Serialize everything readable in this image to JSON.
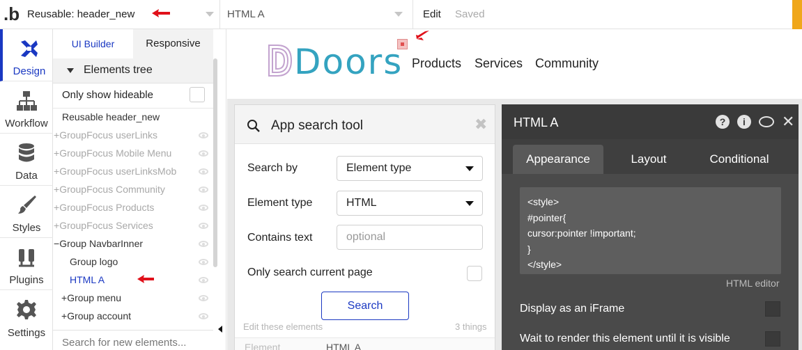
{
  "topbar": {
    "logo": "b",
    "page": "Reusable: header_new",
    "element": "HTML A",
    "edit_label": "Edit",
    "status": "Saved"
  },
  "leftnav": [
    {
      "label": "Design",
      "icon": "design-icon"
    },
    {
      "label": "Workflow",
      "icon": "workflow-icon"
    },
    {
      "label": "Data",
      "icon": "database-icon"
    },
    {
      "label": "Styles",
      "icon": "brush-icon"
    },
    {
      "label": "Plugins",
      "icon": "plug-icon"
    },
    {
      "label": "Settings",
      "icon": "gear-icon"
    }
  ],
  "panel": {
    "tabs": [
      "UI Builder",
      "Responsive"
    ],
    "tree_title": "Elements tree",
    "hideable_label": "Only show hideable",
    "items": [
      {
        "prefix": "",
        "label": "Reusable header_new"
      },
      {
        "prefix": "+",
        "label": "GroupFocus userLinks"
      },
      {
        "prefix": "+",
        "label": "GroupFocus Mobile Menu"
      },
      {
        "prefix": "+",
        "label": "GroupFocus userLinksMob"
      },
      {
        "prefix": "+",
        "label": "GroupFocus Community"
      },
      {
        "prefix": "+",
        "label": "GroupFocus Products"
      },
      {
        "prefix": "+",
        "label": "GroupFocus Services"
      },
      {
        "prefix": "−",
        "label": "Group NavbarInner"
      },
      {
        "prefix": "",
        "label": "Group logo"
      },
      {
        "prefix": "",
        "label": "HTML A"
      },
      {
        "prefix": "+",
        "label": "Group menu"
      },
      {
        "prefix": "+",
        "label": "Group account"
      }
    ],
    "search_placeholder": "Search for new elements..."
  },
  "canvas": {
    "logo_text": "Doors",
    "nav": [
      "Products",
      "Services",
      "Community"
    ]
  },
  "search_tool": {
    "title": "App search tool",
    "search_by_label": "Search by",
    "search_by_value": "Element type",
    "element_type_label": "Element type",
    "element_type_value": "HTML",
    "contains_label": "Contains text",
    "contains_placeholder": "optional",
    "current_page_label": "Only search current page",
    "button": "Search",
    "footer_left": "Edit these elements",
    "footer_right": "3 things",
    "col_header": "Element",
    "col_value": "HTML A"
  },
  "props": {
    "title": "HTML A",
    "tabs": [
      "Appearance",
      "Layout",
      "Conditional"
    ],
    "code": [
      "<style>",
      "#pointer{",
      "cursor:pointer !important;",
      "}",
      "</style>"
    ],
    "editor_label": "HTML editor",
    "opt_iframe": "Display as an iFrame",
    "opt_wait": "Wait to render this element until it is visible"
  },
  "colors": {
    "accent": "#1a38c2",
    "arrow": "#e0101a",
    "logo": "#34a3c0",
    "logo_d": "#c3a3cf"
  }
}
